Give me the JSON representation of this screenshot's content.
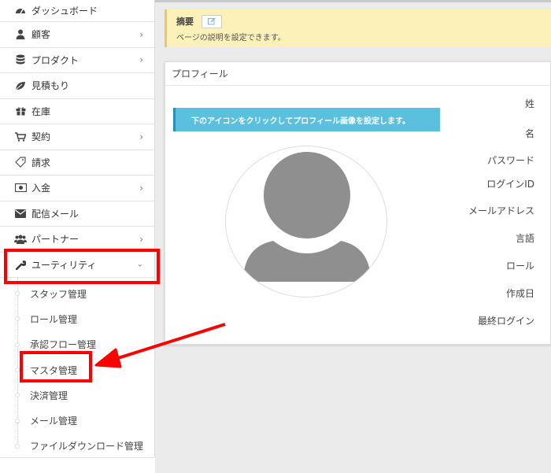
{
  "sidebar": {
    "items": [
      {
        "label": "ダッシュボード",
        "has_chevron": false
      },
      {
        "label": "顧客",
        "has_chevron": true
      },
      {
        "label": "プロダクト",
        "has_chevron": true
      },
      {
        "label": "見積もり",
        "has_chevron": false
      },
      {
        "label": "在庫",
        "has_chevron": false
      },
      {
        "label": "契約",
        "has_chevron": true
      },
      {
        "label": "請求",
        "has_chevron": false
      },
      {
        "label": "入金",
        "has_chevron": true
      },
      {
        "label": "配信メール",
        "has_chevron": false
      },
      {
        "label": "パートナー",
        "has_chevron": true
      },
      {
        "label": "ユーティリティ",
        "has_chevron": true,
        "expanded": true
      }
    ],
    "submenu": [
      {
        "label": "スタッフ管理"
      },
      {
        "label": "ロール管理"
      },
      {
        "label": "承認フロー管理"
      },
      {
        "label": "マスタ管理"
      },
      {
        "label": "決済管理"
      },
      {
        "label": "メール管理"
      },
      {
        "label": "ファイルダウンロード管理"
      }
    ]
  },
  "summary": {
    "title": "摘要",
    "description": "ページの説明を設定できます。"
  },
  "profile": {
    "header": "プロフィール",
    "info": "下のアイコンをクリックしてプロフィール画像を設定します。",
    "fields": [
      "姓",
      "名",
      "パスワード",
      "ログインID",
      "メールアドレス",
      "言語",
      "ロール",
      "作成日",
      "最終ログイン"
    ]
  },
  "colors": {
    "highlight": "#ff0000",
    "info_bar": "#5bc0de",
    "summary_bg": "#fcf1b8",
    "avatar": "#8f8f8f"
  }
}
